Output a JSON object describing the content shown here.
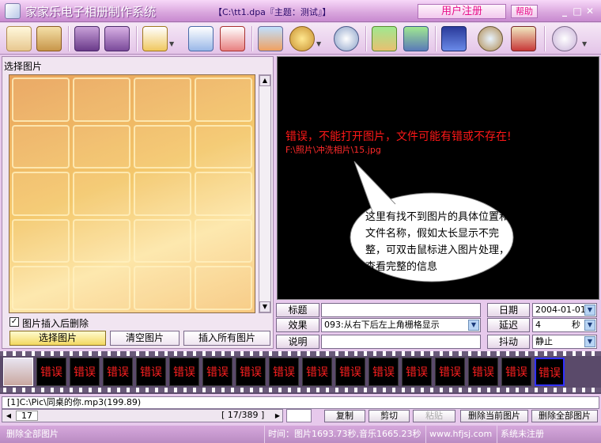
{
  "window": {
    "title": "家家乐电子相册制作系统",
    "file_info": "【C:\\tt1.dpa『主题：测试』】",
    "register_label": "用户注册",
    "help_label": "帮助",
    "controls": [
      "_",
      "□",
      "✕"
    ]
  },
  "toolbar": {
    "icons": [
      "new-album-icon",
      "open-album-icon",
      "save-icon",
      "save-all-icon",
      "add-page-icon",
      "import-icon",
      "delete-page-icon",
      "edit-picture-icon",
      "theme-icon",
      "music-icon",
      "download-icon",
      "export-film-icon",
      "screen-settings-icon",
      "magnifier-icon",
      "tools-icon",
      "disc-icon"
    ]
  },
  "left_panel": {
    "header": "选择图片",
    "delete_after_insert_label": "图片插入后删除",
    "delete_after_insert_checked": true,
    "buttons": [
      "选择图片",
      "清空图片",
      "插入所有图片"
    ]
  },
  "preview": {
    "error_line1": "错误，不能打开图片，文件可能有错或不存在!",
    "error_line2": "F:\\照片\\冲洗相片\\15.jpg",
    "bubble_text": "这里有找不到图片的具体位置和文件名称，假如太长显示不完整，可双击鼠标进入图片处理，查看完整的信息"
  },
  "fields": {
    "title_label": "标题",
    "title_value": "",
    "effect_label": "效果",
    "effect_value": "093:从右下后左上角栅格显示",
    "note_label": "说明",
    "note_value": "",
    "date_label": "日期",
    "date_value": "2004-01-01",
    "delay_label": "延迟",
    "delay_value": "4",
    "delay_unit": "秒",
    "shake_label": "抖动",
    "shake_value": "静止"
  },
  "filmstrip": {
    "frame_label": "错误",
    "frame_count": 16,
    "selected_index": 16
  },
  "music": {
    "line": "[1]C:\\Pic\\同桌的你.mp3(199.89)"
  },
  "pager": {
    "current": "17",
    "count": "[ 17/389 ]"
  },
  "edit_buttons": {
    "copy": "复制",
    "cut": "剪切",
    "paste": "粘贴",
    "delete_current": "删除当前图片",
    "delete_all": "删除全部图片"
  },
  "statusbar": {
    "left": "删除全部图片",
    "time": "时间：图片1693.73秒,音乐1665.23秒",
    "site": "www.hfjsj.com",
    "reg_status": "系统未注册"
  },
  "colors": {
    "title_bar": "#d9a5dd",
    "error_red": "#ff1818",
    "register_pink": "#e8108a",
    "preview_bg": "#000000"
  }
}
